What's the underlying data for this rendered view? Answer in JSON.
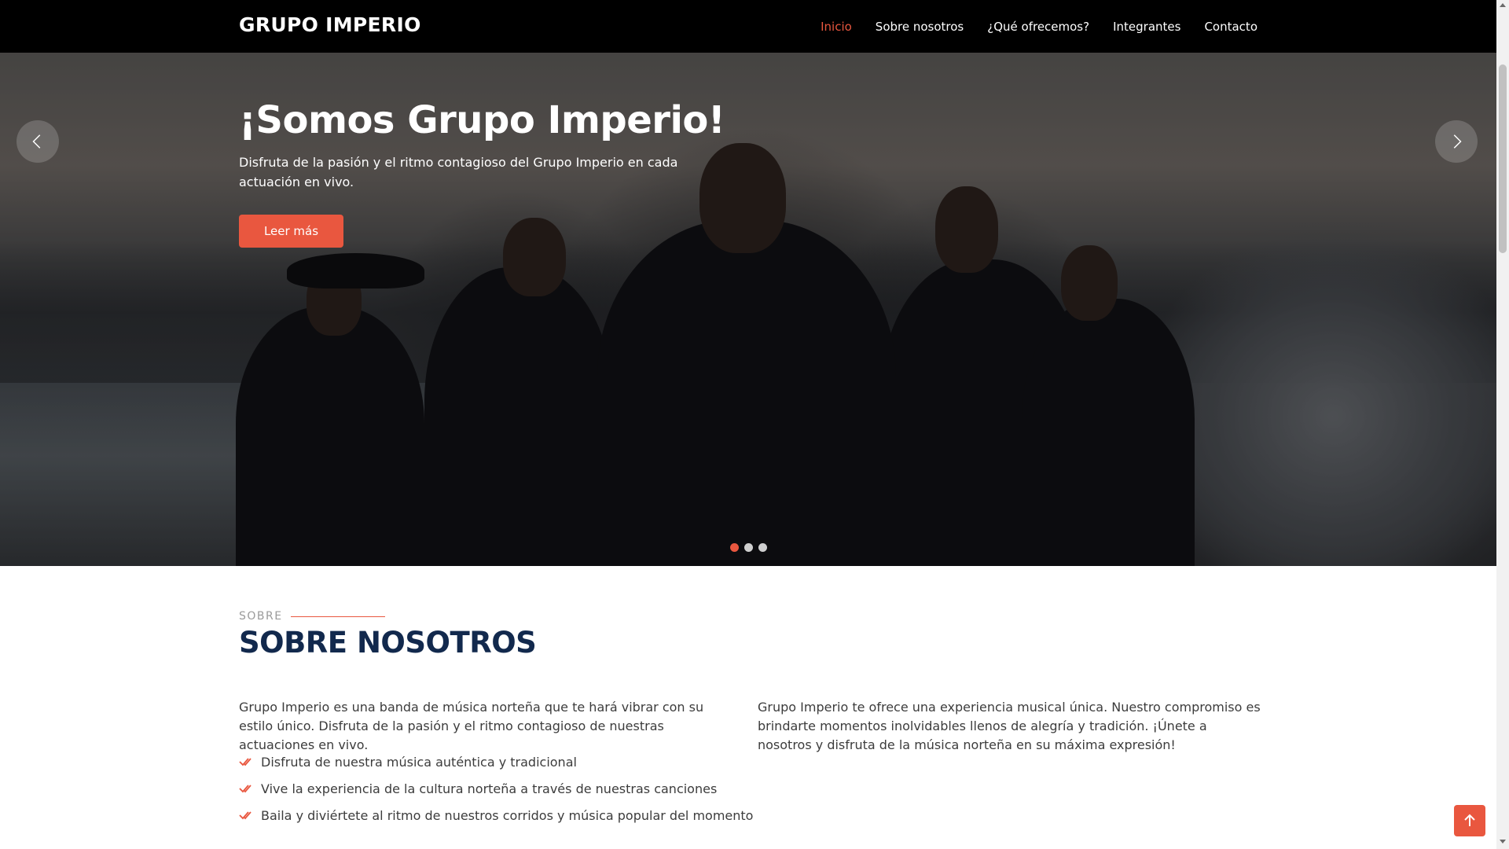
{
  "header": {
    "logo": "GRUPO IMPERIO",
    "nav": [
      {
        "label": "Inicio",
        "active": true
      },
      {
        "label": "Sobre nosotros",
        "active": false
      },
      {
        "label": "¿Qué ofrecemos?",
        "active": false
      },
      {
        "label": "Integrantes",
        "active": false
      },
      {
        "label": "Contacto",
        "active": false
      }
    ]
  },
  "hero": {
    "title": "¡Somos Grupo Imperio!",
    "subtitle": "Disfruta de la pasión y el ritmo contagioso del Grupo Imperio en cada actuación en vivo.",
    "button_label": "Leer más",
    "prev_icon": "chevron-left-icon",
    "next_icon": "chevron-right-icon",
    "slides_total": 3,
    "active_slide": 1
  },
  "about": {
    "eyebrow": "SOBRE",
    "title": "SOBRE NOSOTROS",
    "left_paragraph": "Grupo Imperio es una banda de música norteña que te hará vibrar con su estilo único. Disfruta de la pasión y el ritmo contagioso de nuestras actuaciones en vivo.",
    "checklist": [
      "Disfruta de nuestra música auténtica y tradicional",
      "Vive la experiencia de la cultura norteña a través de nuestras canciones",
      "Baila y diviértete al ritmo de nuestros corridos y música popular del momento"
    ],
    "right_paragraph": "Grupo Imperio te ofrece una experiencia musical única. Nuestro compromiso es brindarte momentos inolvidables llenos de alegría y tradición. ¡Únete a nosotros y disfruta de la música norteña en su máxima expresión!"
  },
  "colors": {
    "accent": "#e9573f",
    "title": "#12294d",
    "header_bg": "#000000"
  },
  "back_to_top_icon": "arrow-up-icon"
}
